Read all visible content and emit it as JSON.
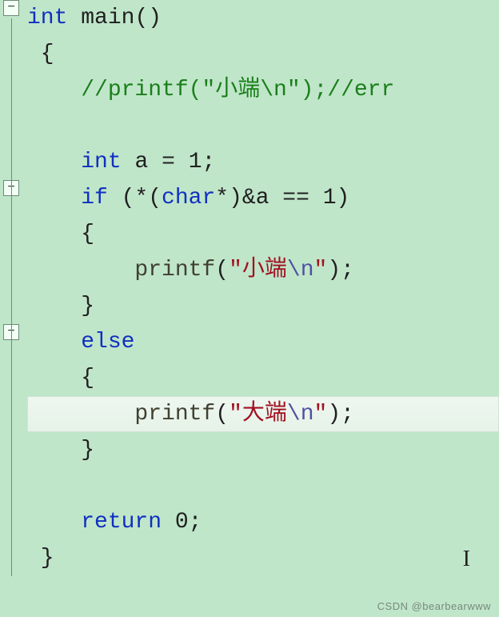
{
  "fold": {
    "minus": "−"
  },
  "kw": {
    "int": "int",
    "if": "if",
    "char": "char",
    "else": "else",
    "return": "return"
  },
  "id": {
    "main": "main",
    "a": "a"
  },
  "fn": {
    "printf": "printf"
  },
  "cmt": {
    "l3": "//printf(\"小端\\n\");//err"
  },
  "str": {
    "q": "\"",
    "little": "小端",
    "big": "大端",
    "nl": "\\n"
  },
  "num": {
    "one": "1",
    "zero": "0"
  },
  "p": {
    "l1a": " ",
    "l1b": "()",
    "l2": " {",
    "ind4": "    ",
    "ind8": "        ",
    "l5a": " ",
    "l5b": " = ",
    "l5c": ";",
    "l6a": " (*(",
    "l6b": "*)&",
    "l6c": " == ",
    "l6d": ")",
    "l7": "{",
    "l8a": "(",
    "l8b": ");",
    "l9": "}",
    "l14a": " ",
    "l14b": ";",
    "l15": " }"
  },
  "watermark": "CSDN @bearbearwww",
  "cursor": "I"
}
